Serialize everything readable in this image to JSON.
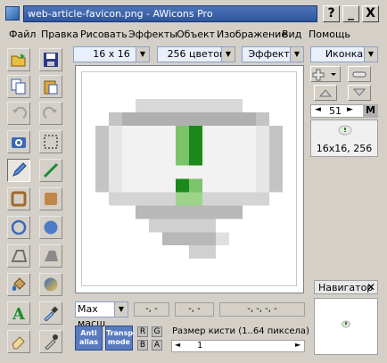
{
  "window": {
    "title": "web-article-favicon.png - AWicons Pro",
    "help_btn": "?",
    "min_btn": "_",
    "close_btn": "X"
  },
  "menu": [
    "Файл",
    "Правка",
    "Рисовать",
    "Эффекты",
    "Объект",
    "Изображение",
    "Вид",
    "Помощь"
  ],
  "options": {
    "size": "16 x 16",
    "colors": "256 цветов",
    "effects": "Эффекты",
    "icon": "Иконка"
  },
  "right_panel": {
    "count": "51",
    "m_label": "M",
    "thumb_label": "16x16, 256"
  },
  "bottom": {
    "zoom": "Max масш",
    "coord1": "-, -",
    "coord2": "-, -",
    "coord3": "-, -, -, -",
    "antialias": "Anti alias",
    "transp_mode": "Transp mode",
    "r": "R",
    "g": "G",
    "b": "B",
    "a": "A",
    "brush_label": "Размер кисти (1..64 пиксела)",
    "brush_value": "1"
  },
  "navigator": {
    "title": "Навигатор",
    "close": "✕"
  },
  "colors": {
    "accent_green": "#1a8a1a",
    "light_green": "#7cc46a",
    "title_blue": "#2f559c"
  },
  "tools": [
    "open-icon",
    "save-icon",
    "copy-icon",
    "paste-icon",
    "undo-icon",
    "redo-icon",
    "screenshot-icon",
    "select-icon",
    "pencil-icon",
    "line-icon",
    "rect-outline-icon",
    "rect-fill-icon",
    "ellipse-outline-icon",
    "ellipse-fill-icon",
    "poly-outline-icon",
    "poly-fill-icon",
    "fill-icon",
    "gradient-icon",
    "text-icon",
    "eyedropper-icon",
    "eraser-icon",
    "picker-icon"
  ]
}
